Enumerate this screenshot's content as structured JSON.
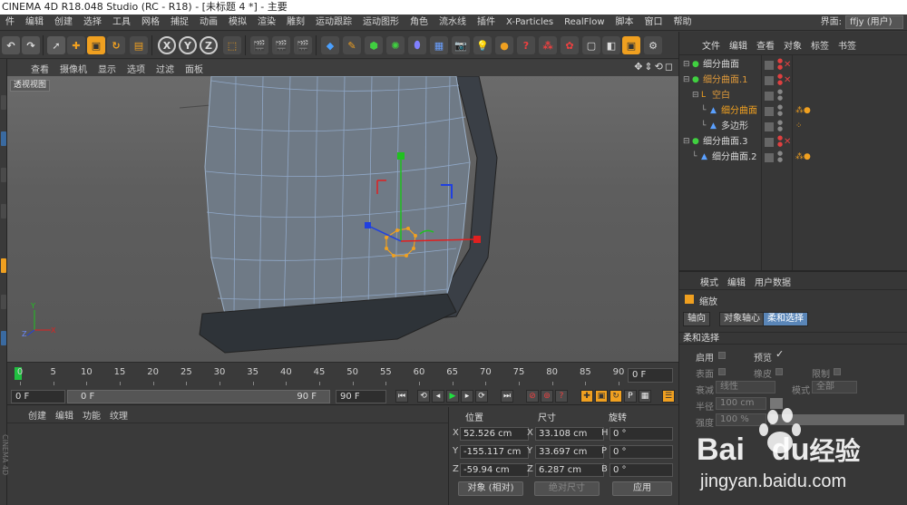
{
  "window": {
    "title": "CINEMA 4D R18.048 Studio (RC - R18) - [未标题 4 *] - 主要"
  },
  "menubar": {
    "items": [
      "件",
      "编辑",
      "创建",
      "选择",
      "工具",
      "网格",
      "捕捉",
      "动画",
      "模拟",
      "渲染",
      "雕刻",
      "运动跟踪",
      "运动图形",
      "角色",
      "流水线",
      "插件",
      "X-Particles",
      "RealFlow",
      "脚本",
      "窗口",
      "帮助"
    ],
    "layout_label": "界面:",
    "layout_value": "ffjy (用户)"
  },
  "viewport": {
    "menu": [
      "查看",
      "摄像机",
      "显示",
      "选项",
      "过滤",
      "面板"
    ],
    "view_label": "透视视图",
    "nav_glyphs": "✥⇕⟲◻"
  },
  "timeline": {
    "ticks": [
      "0",
      "5",
      "10",
      "15",
      "20",
      "25",
      "30",
      "35",
      "40",
      "45",
      "50",
      "55",
      "60",
      "65",
      "70",
      "75",
      "80",
      "85",
      "90"
    ],
    "current_frame": "0 F"
  },
  "playbar": {
    "start": "0 F",
    "range_start": "0 F",
    "range_end": "90 F",
    "end": "90 F"
  },
  "material_panel": {
    "menu": [
      "创建",
      "编辑",
      "功能",
      "纹理"
    ],
    "side_label": "CINEMA 4D"
  },
  "coords": {
    "headers": {
      "position": "位置",
      "size": "尺寸",
      "rotation": "旋转"
    },
    "rows": [
      {
        "axis": "X",
        "pos": "52.526 cm",
        "size_axis": "X",
        "size": "33.108 cm",
        "rot_axis": "H",
        "rot": "0 °"
      },
      {
        "axis": "Y",
        "pos": "-155.117 cm",
        "size_axis": "Y",
        "size": "33.697 cm",
        "rot_axis": "P",
        "rot": "0 °"
      },
      {
        "axis": "Z",
        "pos": "-59.94 cm",
        "size_axis": "Z",
        "size": "6.287 cm",
        "rot_axis": "B",
        "rot": "0 °"
      }
    ],
    "mode_select": "对象 (相对)",
    "size_mode": "绝对尺寸",
    "apply": "应用"
  },
  "objects": {
    "menu": [
      "文件",
      "编辑",
      "查看",
      "对象",
      "标签",
      "书签"
    ],
    "items": [
      {
        "name": "细分曲面",
        "indent": 0,
        "color": "#d8d8d8",
        "kind": "subdiv"
      },
      {
        "name": "细分曲面.1",
        "indent": 0,
        "color": "#e09a3a",
        "kind": "subdiv"
      },
      {
        "name": "空白",
        "indent": 1,
        "color": "#e09a3a",
        "kind": "null"
      },
      {
        "name": "细分曲面",
        "indent": 2,
        "color": "#f0a020",
        "kind": "mesh"
      },
      {
        "name": "多边形",
        "indent": 2,
        "color": "#d8d8d8",
        "kind": "mesh"
      },
      {
        "name": "细分曲面.3",
        "indent": 0,
        "color": "#d8d8d8",
        "kind": "subdiv"
      },
      {
        "name": "细分曲面.2",
        "indent": 1,
        "color": "#d8d8d8",
        "kind": "mesh"
      }
    ]
  },
  "attributes": {
    "menu": [
      "模式",
      "编辑",
      "用户数据"
    ],
    "tool_name": "缩放",
    "tabs": [
      "轴向",
      "对象轴心",
      "柔和选择"
    ],
    "section": "柔和选择",
    "enable_label": "启用",
    "preview_label": "预览",
    "surface_label": "表面",
    "rubber_label": "橡皮",
    "limit_label": "限制",
    "falloff_label": "衰减",
    "falloff_value": "线性",
    "mode_label": "模式",
    "mode_value": "全部",
    "radius_label": "半径",
    "radius_value": "100 cm",
    "strength_label": "强度",
    "strength_value": "100 %"
  },
  "watermark": {
    "brand": "Bai",
    "brand2": "du",
    "suffix": "经验",
    "url": "jingyan.baidu.com"
  },
  "colors": {
    "accent_orange": "#f0a020",
    "axis_red": "#e02020",
    "axis_green": "#20c020",
    "axis_blue": "#2040e0"
  }
}
